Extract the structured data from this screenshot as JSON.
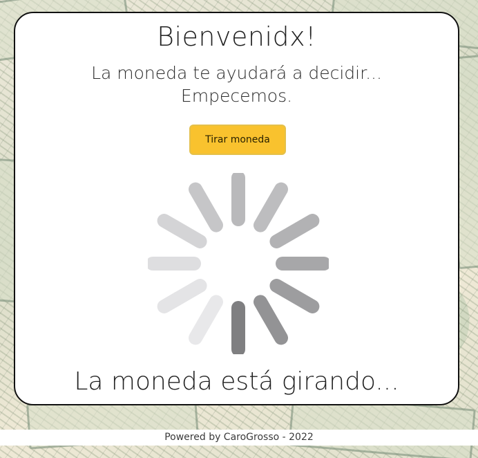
{
  "header": {
    "title": "Bienvenidx!",
    "subtitle_line1": "La moneda te ayudará a decidir...",
    "subtitle_line2": "Empecemos."
  },
  "actions": {
    "flip_button_label": "Tirar moneda"
  },
  "spinner": {
    "icon": "loading-spinner-icon",
    "segment_colors": [
      "#b9b9bb",
      "#bdbdbf",
      "#b2b2b4",
      "#a7a7a9",
      "#9d9d9f",
      "#939395",
      "#7f7f81",
      "#e8e8ea",
      "#e4e4e6",
      "#dedee0",
      "#d4d4d6",
      "#c6c6c8"
    ]
  },
  "status": {
    "text": "La moneda está girando..."
  },
  "footer": {
    "text": "Powered by CaroGrosso - 2022"
  },
  "colors": {
    "button": "#f9c22e",
    "card_border": "#111111"
  }
}
